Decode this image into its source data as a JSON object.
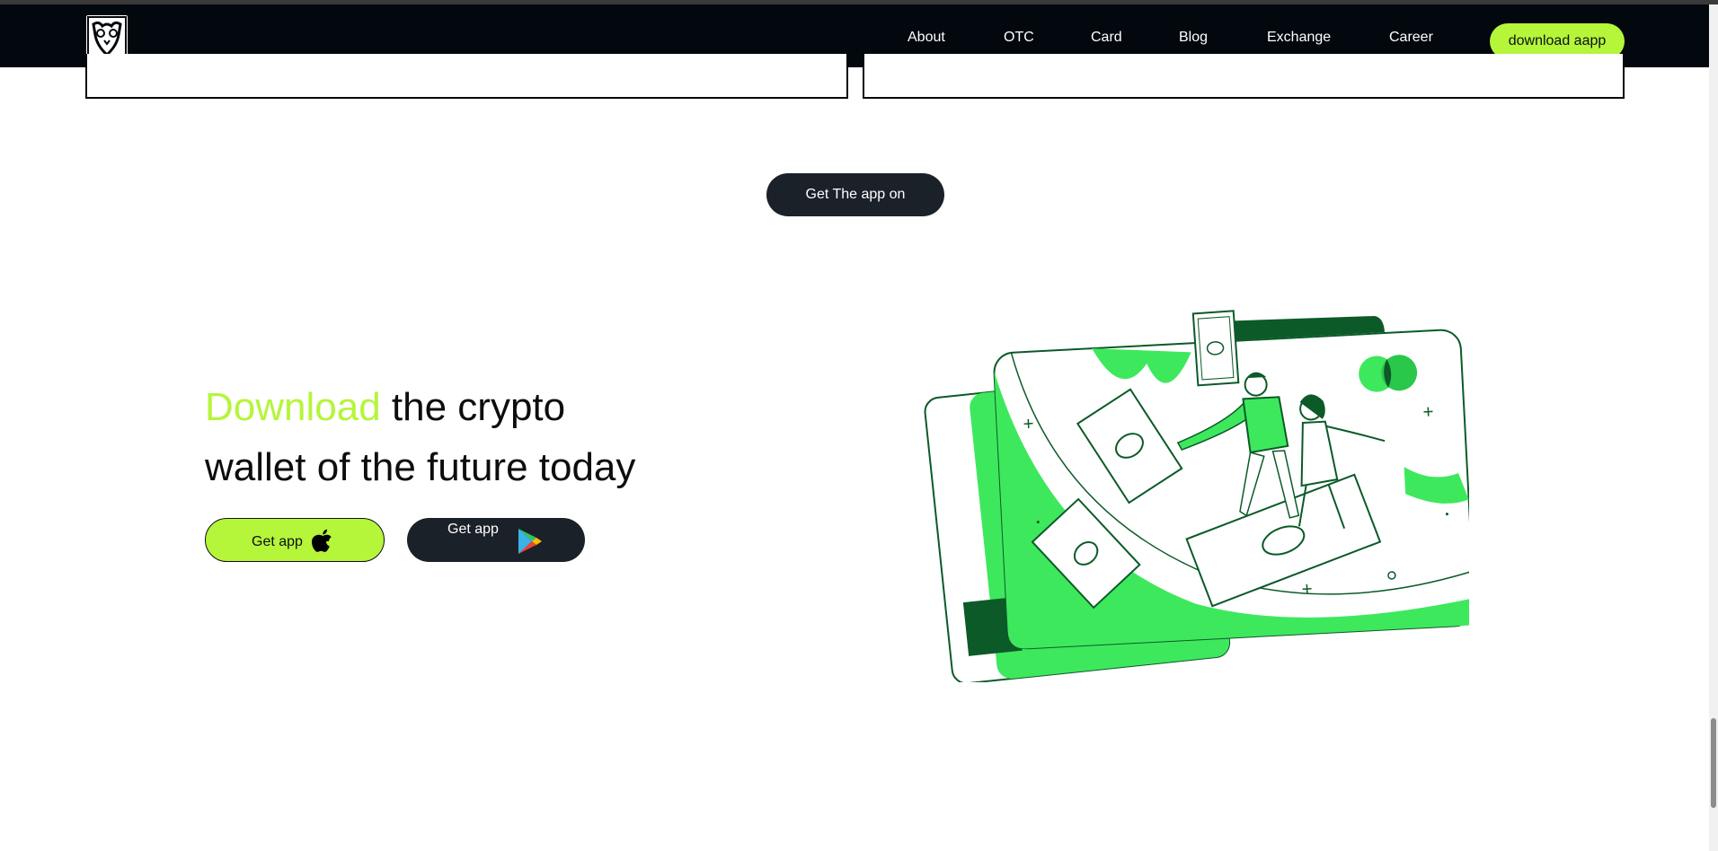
{
  "nav": {
    "logo_icon": "owl-logo-icon",
    "links": [
      "About",
      "OTC",
      "Card",
      "Blog",
      "Exchange",
      "Career"
    ],
    "cta_label": "download aapp"
  },
  "store_cta": {
    "label": "Get The app on"
  },
  "hero": {
    "headline_accent": "Download",
    "headline_rest_line1": " the crypto",
    "headline_line2": "wallet of the future today",
    "apple_button": {
      "label": "Get app",
      "icon": "apple-icon"
    },
    "google_button": {
      "label": "Get app",
      "icon": "google-play-icon"
    }
  },
  "illustration": {
    "icon": "crypto-card-illustration"
  },
  "colors": {
    "accent": "#b5f53a",
    "nav_bg": "#03070e",
    "dark_button": "#1b2129",
    "illustration_green": "#3ee85d"
  }
}
